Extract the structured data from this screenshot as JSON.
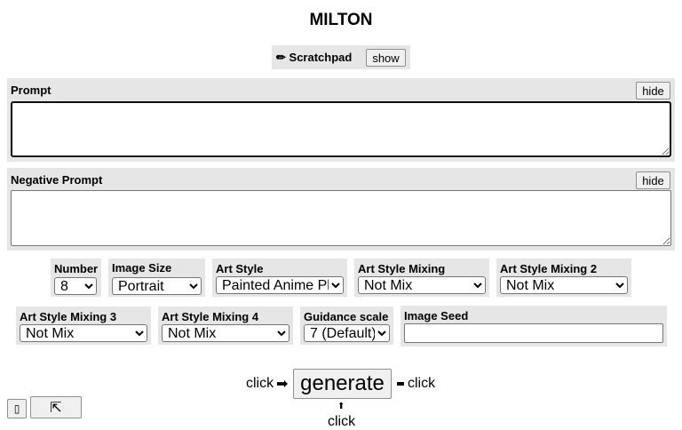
{
  "app": {
    "title": "MILTON"
  },
  "scratchpad": {
    "icon": "✏",
    "label": "Scratchpad",
    "toggle_label": "show"
  },
  "prompt": {
    "label": "Prompt",
    "toggle_label": "hide",
    "value": ""
  },
  "negative_prompt": {
    "label": "Negative Prompt",
    "toggle_label": "hide",
    "value": ""
  },
  "controls": {
    "number": {
      "label": "Number",
      "value": "8"
    },
    "image_size": {
      "label": "Image Size",
      "value": "Portrait"
    },
    "art_style": {
      "label": "Art Style",
      "value": "Painted Anime Pl"
    },
    "art_style_mixing": {
      "label": "Art Style Mixing",
      "value": "Not Mix"
    },
    "art_style_mixing_2": {
      "label": "Art Style Mixing 2",
      "value": "Not Mix"
    },
    "art_style_mixing_3": {
      "label": "Art Style Mixing 3",
      "value": "Not Mix"
    },
    "art_style_mixing_4": {
      "label": "Art Style Mixing 4",
      "value": "Not Mix"
    },
    "guidance_scale": {
      "label": "Guidance scale",
      "value": "7 (Default)"
    },
    "image_seed": {
      "label": "Image Seed",
      "value": ""
    }
  },
  "generate": {
    "label": "generate",
    "hint_left": "click",
    "hint_right": "click",
    "hint_below": "click",
    "arrow_right": "➡",
    "arrow_up": "⬆"
  },
  "bottom_buttons": {
    "left_icon": "▯",
    "expand_icon": "⇱"
  }
}
